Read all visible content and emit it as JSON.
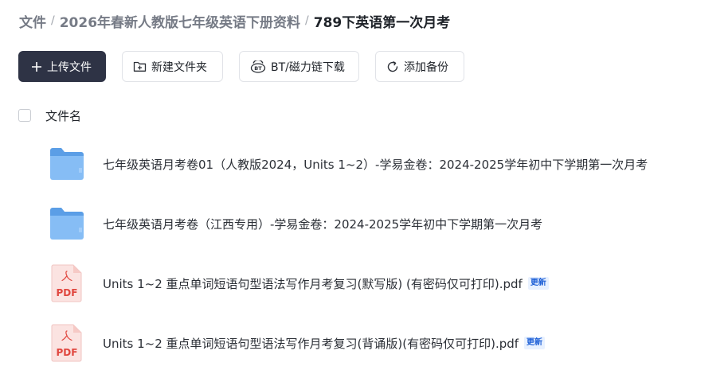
{
  "breadcrumb": {
    "items": [
      "文件",
      "2026年春新人教版七年级英语下册资料"
    ],
    "current": "789下英语第一次月考"
  },
  "toolbar": {
    "upload": "上传文件",
    "new_folder": "新建文件夹",
    "bt_download": "BT/磁力链下载",
    "add_backup": "添加备份"
  },
  "list": {
    "header": "文件名",
    "files": [
      {
        "type": "folder",
        "icon": "folder-icon",
        "name": "七年级英语月考卷01（人教版2024，Units 1~2）-学易金卷：2024-2025学年初中下学期第一次月考"
      },
      {
        "type": "folder",
        "icon": "folder-icon",
        "name": "七年级英语月考卷（江西专用）-学易金卷：2024-2025学年初中下学期第一次月考"
      },
      {
        "type": "pdf",
        "icon": "pdf-icon",
        "icon_text": "PDF",
        "name": "Units 1~2 重点单词短语句型语法写作月考复习(默写版) (有密码仅可打印).pdf",
        "badge": "更新"
      },
      {
        "type": "pdf",
        "icon": "pdf-icon",
        "icon_text": "PDF",
        "name": "Units 1~2 重点单词短语句型语法写作月考复习(背诵版)(有密码仅可打印).pdf",
        "badge": "更新"
      }
    ]
  },
  "colors": {
    "primary_button": "#2e3345",
    "folder": "#7fb6f2",
    "pdf_red": "#e0463e",
    "badge_text": "#1d5fd6",
    "badge_bg": "#e8f1ff"
  }
}
